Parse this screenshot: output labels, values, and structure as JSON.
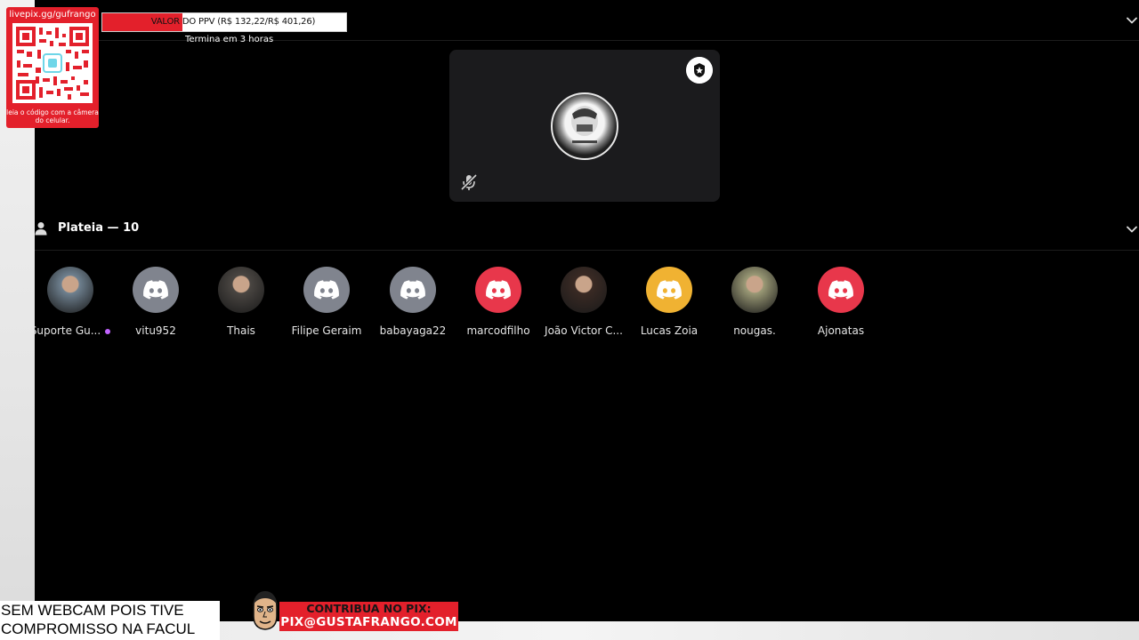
{
  "overlay": {
    "qr_url": "livepix.gg/gufrango",
    "qr_caption": "leia o código com a câmera do celular.",
    "ppv_label": "VALOR DO PPV (R$ 132,22/R$ 401,26)",
    "ppv_progress_fraction": 0.33,
    "ppv_ends": "Termina em 3 horas",
    "webcam_note_line1": "SEM WEBCAM POIS TIVE",
    "webcam_note_line2": "COMPROMISSO NA FACUL",
    "pix_label": "CONTRIBUA NO PIX:",
    "pix_key": "PIX@GUSTAFRANGO.COM",
    "brand_red": "#e3202b"
  },
  "stage": {
    "speaker_avatar_icon": "speaker-avatar",
    "badge_icon": "moderator-badge-icon",
    "mute_icon": "mic-muted-icon"
  },
  "audience": {
    "title": "Plateia — 10",
    "members": [
      {
        "name": "Suporte Gu...",
        "avatar": "photo",
        "color": "#6f8190",
        "boosted": true
      },
      {
        "name": "vitu952",
        "avatar": "discord",
        "color": "#80848e"
      },
      {
        "name": "Thais",
        "avatar": "photo",
        "color": "#4a4642"
      },
      {
        "name": "Filipe Geraim",
        "avatar": "discord",
        "color": "#80848e"
      },
      {
        "name": "babayaga22",
        "avatar": "discord",
        "color": "#80848e"
      },
      {
        "name": "marcodfilho",
        "avatar": "discord",
        "color": "#e8374b"
      },
      {
        "name": "João Victor C...",
        "avatar": "photo",
        "color": "#3a2a24"
      },
      {
        "name": "Lucas Zoia",
        "avatar": "discord",
        "color": "#f0b232"
      },
      {
        "name": "nougas.",
        "avatar": "photo",
        "color": "#9b9a76"
      },
      {
        "name": "Ajonatas",
        "avatar": "discord",
        "color": "#e8374b"
      }
    ]
  }
}
